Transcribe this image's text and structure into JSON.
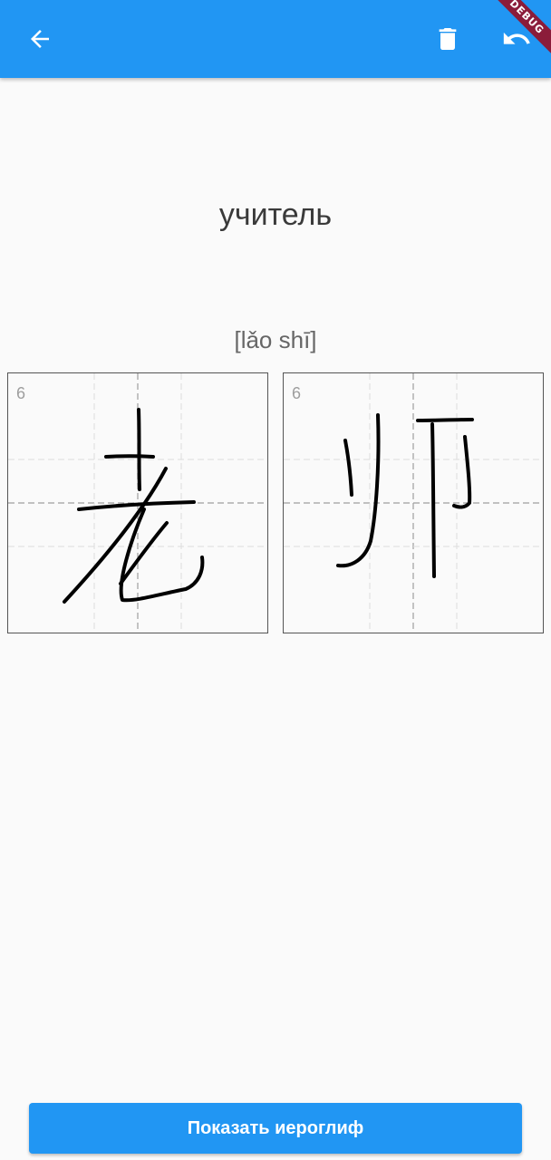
{
  "appbar": {
    "back_icon": "arrow-back-icon",
    "delete_icon": "trash-icon",
    "undo_icon": "undo-icon",
    "debug_label": "DEBUG",
    "color": "#2196f3"
  },
  "word": "учитель",
  "pinyin": "[lǎo shī]",
  "cells": [
    {
      "stroke_count": "6"
    },
    {
      "stroke_count": "6"
    }
  ],
  "show_button": {
    "label": "Показать иероглиф"
  }
}
